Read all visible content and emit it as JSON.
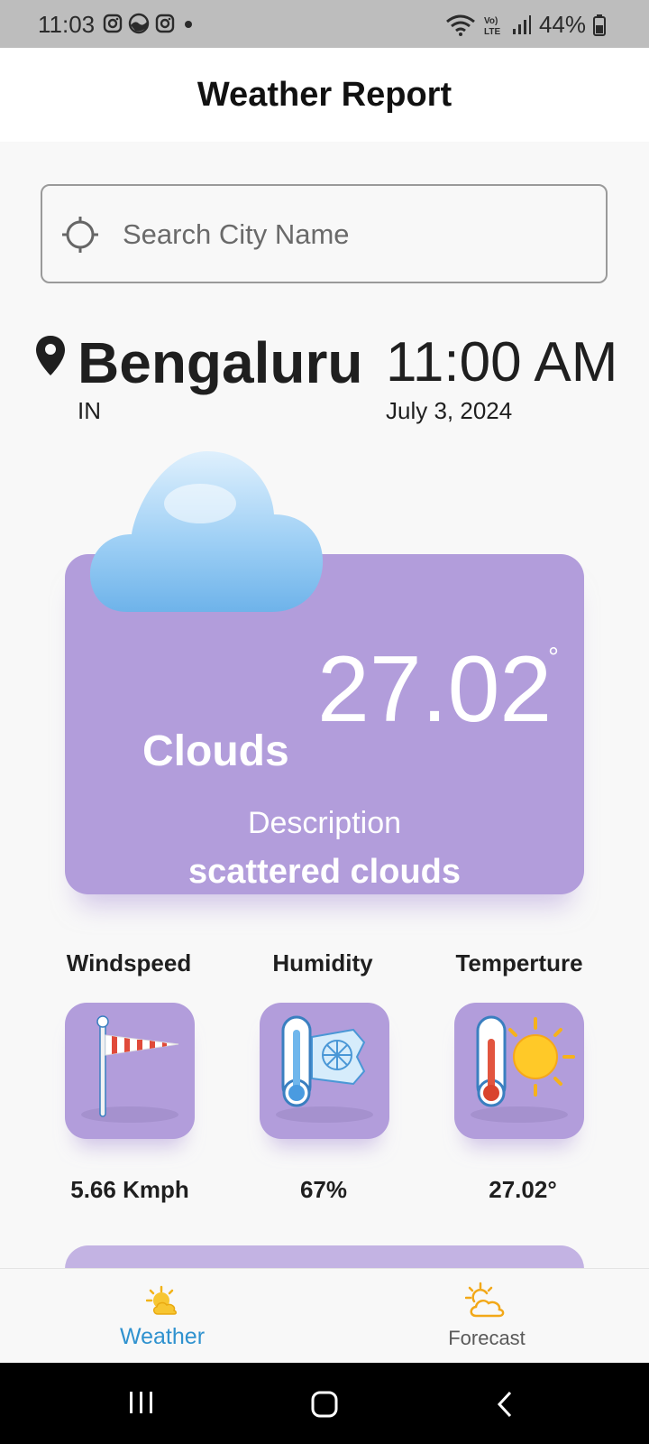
{
  "status_bar": {
    "time": "11:03",
    "battery": "44%",
    "icons": [
      "instagram-icon",
      "app-icon",
      "instagram-icon",
      "notification-dot-icon",
      "wifi-icon",
      "volte-icon",
      "signal-icon",
      "battery-icon"
    ]
  },
  "app_bar": {
    "title": "Weather Report"
  },
  "search": {
    "placeholder": "Search City Name",
    "icon": "crosshair-icon"
  },
  "location": {
    "city": "Bengaluru",
    "country": "IN",
    "time": "11:00 AM",
    "date": "July 3, 2024"
  },
  "current": {
    "temperature": "27.02",
    "degree_symbol": "°",
    "condition": "Clouds",
    "description_label": "Description",
    "description": "scattered clouds",
    "icon": "cloud-icon"
  },
  "stats": [
    {
      "label": "Windspeed",
      "value": "5.66 Kmph",
      "icon": "windsock-icon"
    },
    {
      "label": "Humidity",
      "value": "67%",
      "icon": "thermometer-cold-icon"
    },
    {
      "label": "Temperture",
      "value": "27.02°",
      "icon": "thermometer-sun-icon"
    }
  ],
  "bottom_nav": {
    "items": [
      {
        "label": "Weather",
        "icon": "sun-cloud-icon",
        "active": true
      },
      {
        "label": "Forecast",
        "icon": "partly-cloudy-icon",
        "active": false
      }
    ]
  },
  "colors": {
    "card": "#b29ddb",
    "active_nav": "#2f92cf",
    "status_bar": "#bdbdbd"
  }
}
